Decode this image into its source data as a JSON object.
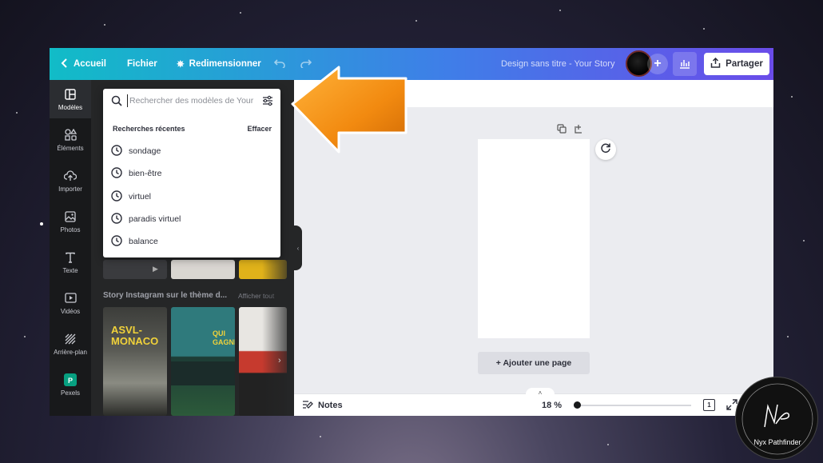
{
  "topbar": {
    "home_label": "Accueil",
    "file_label": "Fichier",
    "resize_label": "Redimensionner",
    "design_title": "Design sans titre - Your Story",
    "share_label": "Partager"
  },
  "rail": {
    "items": [
      {
        "label": "Modèles",
        "icon": "templates-icon"
      },
      {
        "label": "Éléments",
        "icon": "elements-icon"
      },
      {
        "label": "Importer",
        "icon": "upload-icon"
      },
      {
        "label": "Photos",
        "icon": "photos-icon"
      },
      {
        "label": "Texte",
        "icon": "text-icon"
      },
      {
        "label": "Vidéos",
        "icon": "video-icon"
      },
      {
        "label": "Arrière-plan",
        "icon": "background-icon"
      },
      {
        "label": "Pexels",
        "icon": "pexels-icon"
      }
    ]
  },
  "search": {
    "placeholder": "Rechercher des modèles de Your Story"
  },
  "recent": {
    "title": "Recherches récentes",
    "clear_label": "Effacer",
    "items": [
      "sondage",
      "bien-être",
      "virtuel",
      "paradis virtuel",
      "balance"
    ]
  },
  "panel": {
    "section_title": "Story Instagram sur le thème d...",
    "section_link": "Afficher tout",
    "thumb1_text": "ASVL-\nMONACO",
    "thumb2_text": "QUI\nGAGNE ?"
  },
  "canvas": {
    "add_page_label": "+ Ajouter une page"
  },
  "bottombar": {
    "notes_label": "Notes",
    "zoom_label": "18 %",
    "page_count": "1"
  },
  "watermark": {
    "name": "Nyx Pathfinder"
  },
  "colors": {
    "topbar_start": "#11bcc7",
    "topbar_end": "#6a4ce9",
    "arrow": "#f39a1b"
  }
}
